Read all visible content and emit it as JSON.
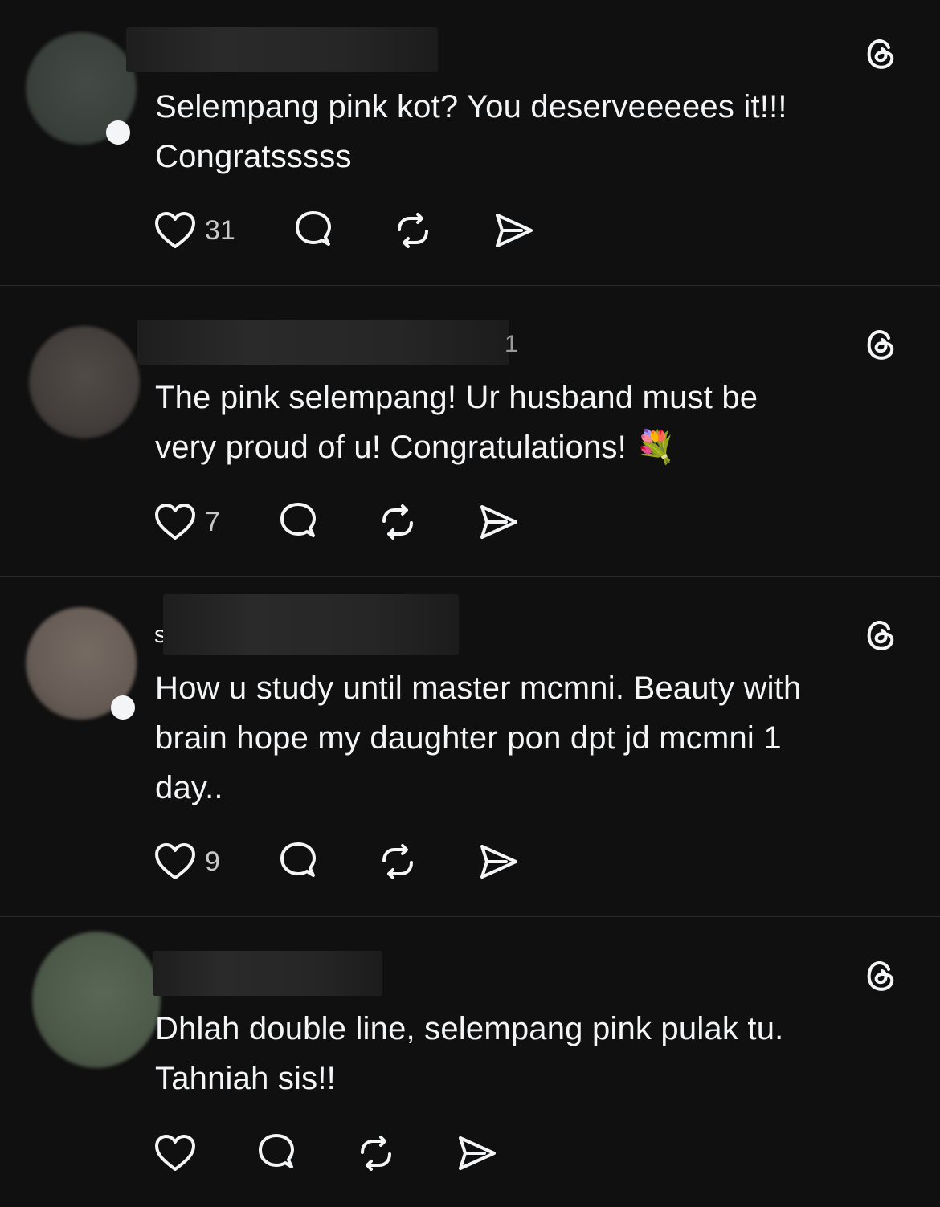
{
  "posts": [
    {
      "name_fragment": "",
      "text_lines": [
        "Selempang pink kot? You deserveeeees it!!!",
        "Congratsssss"
      ],
      "likes": "31",
      "avatar_color": "#3d4440"
    },
    {
      "name_fragment": "1",
      "text_lines": [
        "The pink selempang! Ur husband must be",
        "very proud of u! Congratulations! 💐"
      ],
      "likes": "7",
      "avatar_color": "#4a4542"
    },
    {
      "name_fragment": "s",
      "text_lines": [
        "How u study until master mcmni. Beauty with",
        "brain hope my daughter pon dpt jd mcmni 1",
        "day.."
      ],
      "likes": "9",
      "avatar_color": "#6b615a"
    },
    {
      "name_fragment": "",
      "text_lines": [
        "Dhlah double line, selempang pink pulak tu.",
        "Tahniah sis!!"
      ],
      "likes": "",
      "avatar_color": "#4d5a4b"
    }
  ],
  "icons": {
    "like": "heart-icon",
    "reply": "comment-icon",
    "repost": "repost-icon",
    "share": "share-icon",
    "brand": "threads-logo-icon"
  },
  "colors": {
    "background": "#101010",
    "text": "#f3f5f7",
    "divider": "#2b2b2b"
  }
}
